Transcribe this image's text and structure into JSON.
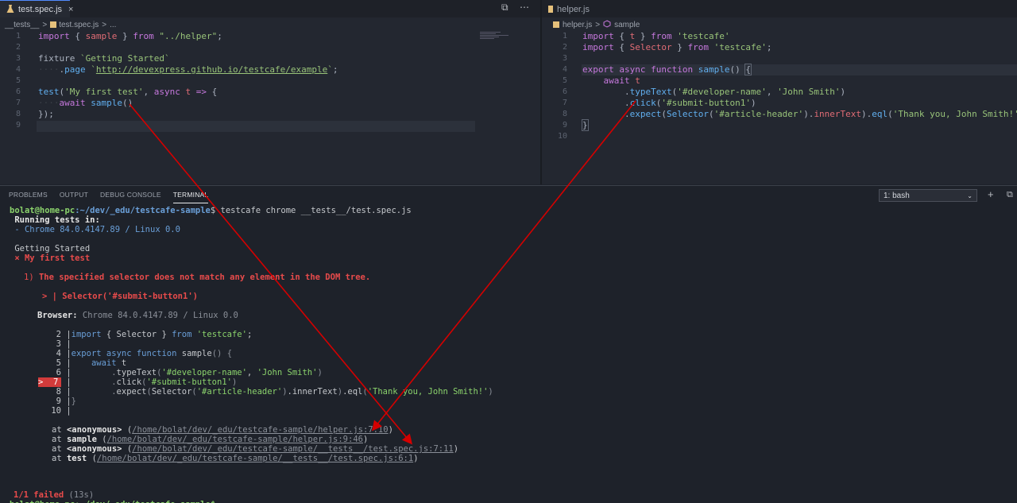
{
  "left_editor": {
    "tab_label": "test.spec.js",
    "close": "×",
    "breadcrumb": [
      "__tests__",
      ">",
      "test.spec.js",
      ">",
      "..."
    ],
    "lines": [
      {
        "n": "1",
        "src": "import { sample } from \"../helper\";"
      },
      {
        "n": "2",
        "src": ""
      },
      {
        "n": "3",
        "src": "fixture `Getting Started`"
      },
      {
        "n": "4",
        "src": "    .page `http://devexpress.github.io/testcafe/example`;"
      },
      {
        "n": "5",
        "src": ""
      },
      {
        "n": "6",
        "src": "test('My first test', async t => {"
      },
      {
        "n": "7",
        "src": "    await sample()"
      },
      {
        "n": "8",
        "src": "});"
      },
      {
        "n": "9",
        "src": ""
      }
    ],
    "actions": [
      "⧉",
      "⋯"
    ]
  },
  "right_editor": {
    "tab_label": "helper.js",
    "breadcrumb": [
      "helper.js",
      ">",
      "sample"
    ],
    "lines": [
      {
        "n": "1",
        "src": "import { t } from 'testcafe'"
      },
      {
        "n": "2",
        "src": "import { Selector } from 'testcafe';"
      },
      {
        "n": "3",
        "src": ""
      },
      {
        "n": "4",
        "src": "export async function sample() {"
      },
      {
        "n": "5",
        "src": "    await t"
      },
      {
        "n": "6",
        "src": "        .typeText('#developer-name', 'John Smith')"
      },
      {
        "n": "7",
        "src": "        .click('#submit-button1')"
      },
      {
        "n": "8",
        "src": "        .expect(Selector('#article-header').innerText).eql('Thank you, John Smith!')"
      },
      {
        "n": "9",
        "src": "}"
      },
      {
        "n": "10",
        "src": ""
      }
    ]
  },
  "panel": {
    "tabs": [
      "PROBLEMS",
      "OUTPUT",
      "DEBUG CONSOLE",
      "TERMINAL"
    ],
    "active_tab": "TERMINAL",
    "shell_select": "1: bash",
    "add": "+",
    "split": "⧉"
  },
  "terminal": {
    "prompt_user": "bolat@home-pc",
    "prompt_path": ":~/dev/_edu/testcafe-sample",
    "prompt_cmd": "$ testcafe chrome __tests__/test.spec.js",
    "running": " Running tests in:",
    "browser_line": " - Chrome 84.0.4147.89 / Linux 0.0",
    "fixture": " Getting Started",
    "fail_test": " × My first test",
    "err_num": "1) ",
    "err_msg": "The specified selector does not match any element in the DOM tree.",
    "selector_line": "> | Selector('#submit-button1')",
    "browser_label": "Browser:",
    "browser_value": " Chrome 84.0.4147.89 / Linux 0.0",
    "code": [
      {
        "n": "2",
        "src": "import { Selector } from 'testcafe';"
      },
      {
        "n": "3",
        "src": ""
      },
      {
        "n": "4",
        "src": "export async function sample() {"
      },
      {
        "n": "5",
        "src": "    await t"
      },
      {
        "n": "6",
        "src": "        .typeText('#developer-name', 'John Smith')"
      },
      {
        "n": "7",
        "src": "        .click('#submit-button1')"
      },
      {
        "n": "8",
        "src": "        .expect(Selector('#article-header').innerText).eql('Thank you, John Smith!')"
      },
      {
        "n": "9",
        "src": "}"
      },
      {
        "n": "10",
        "src": ""
      }
    ],
    "mark": ">  7",
    "stack": [
      {
        "at": "at ",
        "fn": "<anonymous>",
        "path": "/home/bolat/dev/_edu/testcafe-sample/helper.js:7:10"
      },
      {
        "at": "at ",
        "fn": "sample",
        "path": "/home/bolat/dev/_edu/testcafe-sample/helper.js:9:46"
      },
      {
        "at": "at ",
        "fn": "<anonymous>",
        "path": "/home/bolat/dev/_edu/testcafe-sample/__tests__/test.spec.js:7:11"
      },
      {
        "at": "at ",
        "fn": "test",
        "path": "/home/bolat/dev/_edu/testcafe-sample/__tests__/test.spec.js:6:1"
      }
    ],
    "summary": "1/1 failed",
    "summary_time": " (13s)",
    "last_prompt": "bolat@home-pc:~/dev/_edu/testcafe-sample$ "
  },
  "colors": {
    "accent": "#528bff",
    "error": "#e84b4b",
    "annotation_arrow": "#d40000"
  }
}
